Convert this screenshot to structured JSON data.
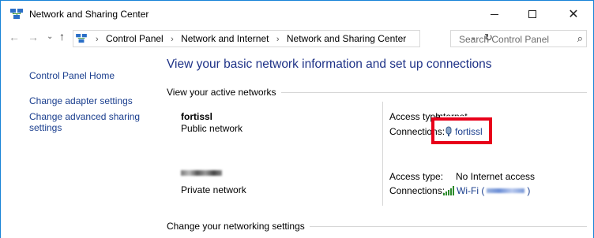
{
  "window": {
    "title": "Network and Sharing Center",
    "controls": {
      "minimize": "—",
      "maximize": "☐",
      "close": "✕"
    }
  },
  "nav": {
    "back": "←",
    "forward": "→",
    "recent": "⌄",
    "up": "↑",
    "breadcrumbs": [
      "Control Panel",
      "Network and Internet",
      "Network and Sharing Center"
    ],
    "breadcrumb_sep": "›",
    "dropdown": "⌄",
    "refresh": "↻",
    "search_placeholder": "Search Control Panel",
    "search_icon": "⌕"
  },
  "sidebar": {
    "home": "Control Panel Home",
    "items": [
      "Change adapter settings",
      "Change advanced sharing\nsettings"
    ]
  },
  "main": {
    "title": "View your basic network information and set up connections",
    "active_networks_label": "View your active networks",
    "networks": [
      {
        "name": "fortissl",
        "category": "Public network",
        "access_type_label": "Access type:",
        "access_type_value": "Internet",
        "connections_label": "Connections:",
        "connection_name": "fortissl"
      },
      {
        "name": "",
        "category": "Private network",
        "access_type_label": "Access type:",
        "access_type_value": "No Internet access",
        "connections_label": "Connections:",
        "connection_name_prefix": "Wi-Fi (",
        "connection_name_suffix": ")"
      }
    ],
    "change_settings_label": "Change your networking settings"
  },
  "colors": {
    "link": "#1a3e8e",
    "title_blue": "#1e3287",
    "highlight_red": "#e8001a",
    "window_border": "#1883d7"
  },
  "icons": {
    "app": "network-sharing-icon",
    "vpn": "vpn-connection-icon",
    "wifi": "wifi-signal-icon"
  }
}
